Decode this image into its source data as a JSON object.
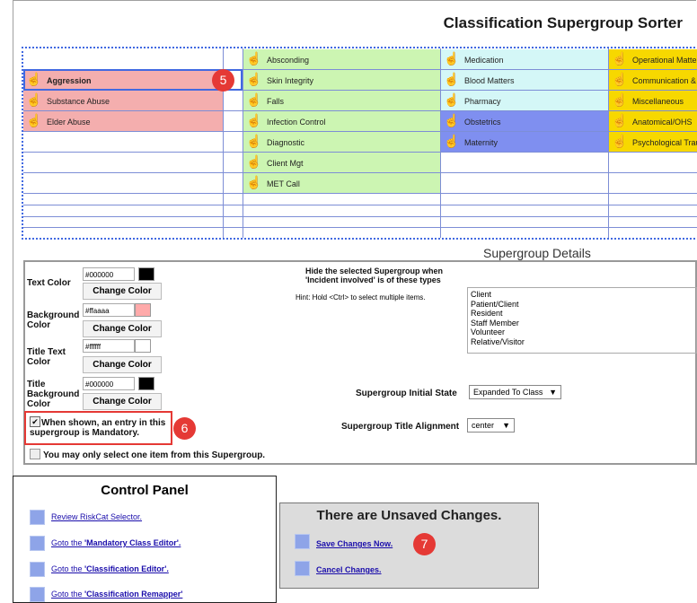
{
  "header": {
    "title": "Classification Supergroup Sorter"
  },
  "sorter": {
    "col1": [
      {
        "label": "Aggression",
        "bold": true
      },
      {
        "label": "Substance Abuse",
        "bold": false
      },
      {
        "label": "Elder Abuse",
        "bold": false
      }
    ],
    "col2": [
      "Absconding",
      "Skin Integrity",
      "Falls",
      "Infection Control",
      "Diagnostic",
      "Client Mgt",
      "MET Call"
    ],
    "col3": [
      "Medication",
      "Blood Matters",
      "Pharmacy",
      "Obstetrics",
      "Maternity"
    ],
    "col4": [
      "Operational Matte",
      "Communication &",
      "Miscellaneous",
      "Anatomical/OHS",
      "Psychological Trau"
    ],
    "colors": {
      "pink": "#f4aeae",
      "green": "#ccf5b2",
      "cyan": "#d4f7f7",
      "blue": "#7f8ff0",
      "yellow": "#f7d800"
    }
  },
  "markers": {
    "m5": "5",
    "m6": "6",
    "m7": "7"
  },
  "details": {
    "title": "Supergroup Details",
    "text_color_label": "Text Color",
    "text_color_value": "#000000",
    "bg_color_label": "Background Color",
    "bg_color_value": "#ffaaaa",
    "title_text_color_label": "Title Text Color",
    "title_text_color_value": "#ffffff",
    "title_bg_color_label": "Title Background Color",
    "title_bg_color_value": "#000000",
    "change_color": "Change Color",
    "mandatory_checkbox": "When shown, an entry in this supergroup is Mandatory.",
    "single_checkbox": "You may only select one item from this Supergroup.",
    "hide_heading_1": "Hide the selected Supergroup when",
    "hide_heading_2": "'Incident involved' is of these types",
    "hint": "Hint: Hold <Ctrl> to select multiple items.",
    "types": [
      "Client",
      "Patient/Client",
      "Resident",
      "Staff Member",
      "Volunteer",
      "Relative/Visitor"
    ],
    "initial_state_label": "Supergroup Initial State",
    "initial_state_value": "Expanded To Class",
    "alignment_label": "Supergroup Title Alignment",
    "alignment_value": "center"
  },
  "control_panel": {
    "title": "Control Panel",
    "links": [
      {
        "prefix": "Review RiskCat Selector.",
        "bold": ""
      },
      {
        "prefix": "Goto the ",
        "bold": "'Mandatory Class Editor'."
      },
      {
        "prefix": "Goto the ",
        "bold": "'Classification Editor'."
      },
      {
        "prefix": "Goto the ",
        "bold": "'Classification Remapper'"
      }
    ]
  },
  "unsaved": {
    "title": "There are Unsaved Changes.",
    "save": "Save Changes Now.",
    "cancel": "Cancel Changes."
  }
}
